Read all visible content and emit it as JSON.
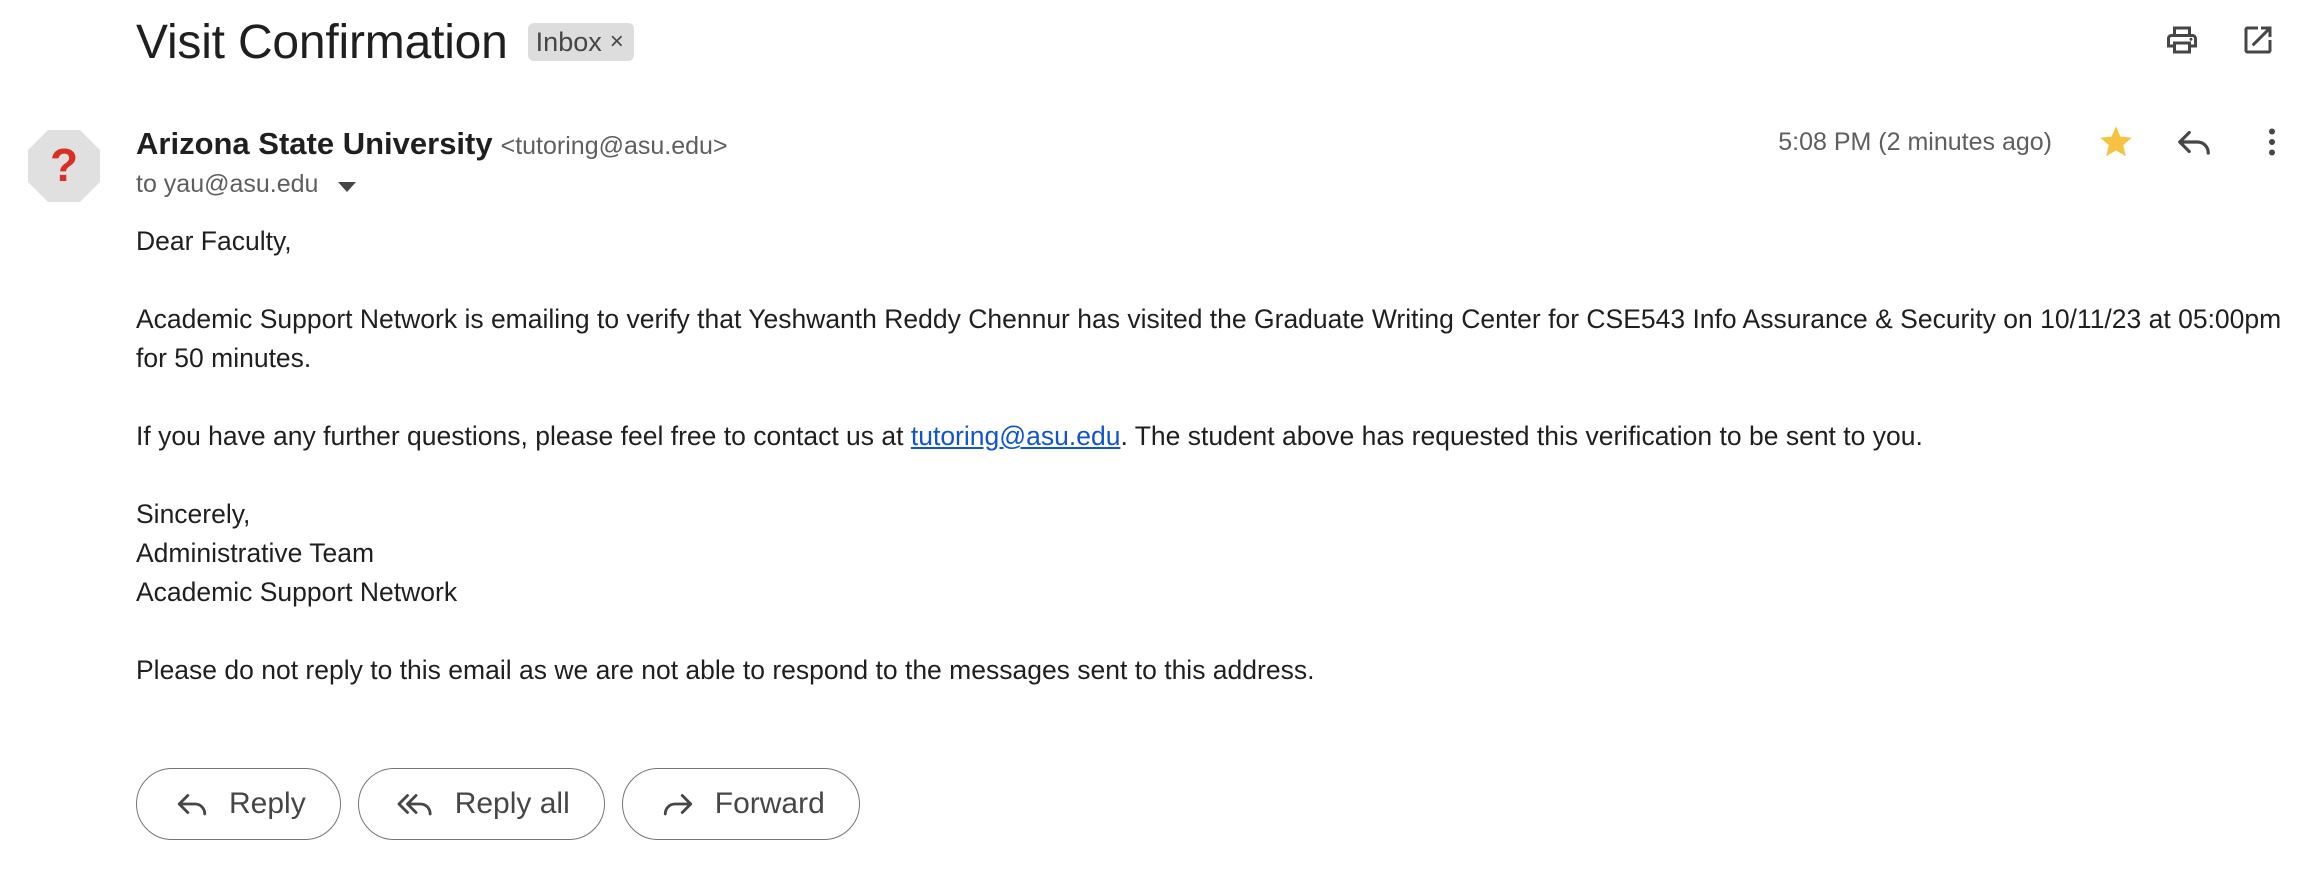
{
  "header": {
    "subject": "Visit Confirmation",
    "label": "Inbox",
    "label_remove": "×"
  },
  "sender": {
    "name": "Arizona State University",
    "email": "<tutoring@asu.edu>",
    "to": "to yau@asu.edu",
    "timestamp": "5:08 PM (2 minutes ago)",
    "avatar_glyph": "?"
  },
  "body": {
    "greeting": "Dear Faculty,",
    "paragraph1": "Academic Support Network is emailing to verify that Yeshwanth Reddy Chennur has visited the Graduate Writing Center for CSE543 Info Assurance & Security on 10/11/23 at 05:00pm for 50 minutes.",
    "paragraph2_before": "If you have any further questions, please feel free to contact us at ",
    "paragraph2_link": "tutoring@asu.edu",
    "paragraph2_after": ". The student above has requested this verification to be sent to you.",
    "sign_off": "Sincerely,",
    "sign_team": "Administrative Team",
    "sign_org": "Academic Support Network",
    "footer": "Please do not reply to this email as we are not able to respond to the messages sent to this address."
  },
  "actions": {
    "reply": "Reply",
    "reply_all": "Reply all",
    "forward": "Forward"
  },
  "icons": {
    "print": "print-icon",
    "open_new_window": "open-in-new-icon",
    "star": "star-icon",
    "reply": "reply-icon",
    "more": "more-vert-icon"
  },
  "colors": {
    "star": "#f5c242",
    "avatar_bg": "#e0e0e0",
    "avatar_glyph": "#d93025",
    "link": "#1155cc",
    "chip_bg": "#dddddd"
  }
}
